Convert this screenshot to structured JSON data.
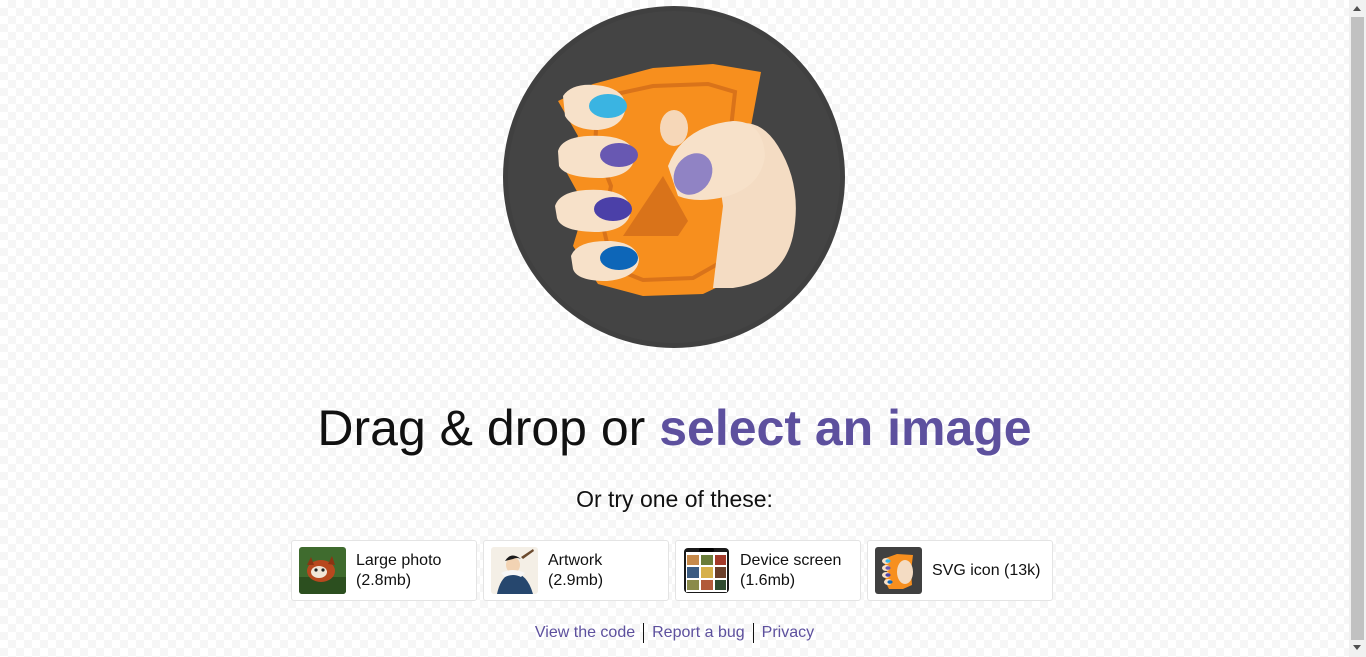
{
  "headline": {
    "prefix": "Drag & drop or ",
    "link": "select an image"
  },
  "subhead": "Or try one of these:",
  "demos": [
    {
      "label": "Large photo\n(2.8mb)",
      "icon": "red-panda-photo-thumbnail"
    },
    {
      "label": "Artwork\n(2.9mb)",
      "icon": "artwork-thumbnail"
    },
    {
      "label": "Device screen\n(1.6mb)",
      "icon": "device-screen-thumbnail"
    },
    {
      "label": "SVG icon (13k)",
      "icon": "svg-icon-thumbnail"
    }
  ],
  "footer": {
    "links": [
      "View the code",
      "Report a bug",
      "Privacy"
    ]
  },
  "colors": {
    "accent": "#5d509e",
    "logo_circle": "#404040",
    "logo_orange": "#f78f1e"
  }
}
